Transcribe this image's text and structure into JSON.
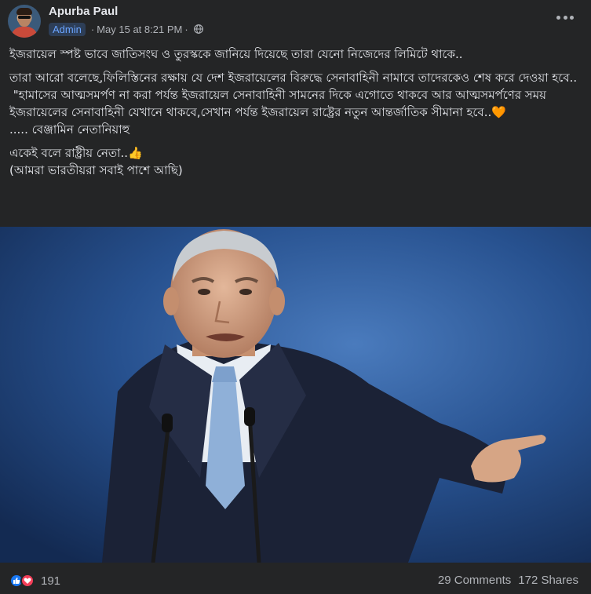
{
  "post": {
    "author": "Apurba Paul",
    "role_badge": "Admin",
    "timestamp": "May 15 at 8:21 PM",
    "separator": "·",
    "privacy_icon": "globe-icon",
    "more_icon": "more-options-icon"
  },
  "content": {
    "line1": "ইজরায়েল স্পষ্ট ভাবে জাতিসংঘ ও তুরস্ককে জানিয়ে দিয়েছে তারা যেনো নিজেদের লিমিটে থাকে..",
    "line2": "তারা আরো বলেছে,ফিলিস্তিনের রক্ষায় যে দেশ ইজরায়েলের বিরুদ্ধে সেনাবাহিনী নামাবে তাদেরকেও শেষ করে দেওয়া হবে..",
    "line3": " \"হামাসের আত্মসমর্পণ না করা পর্যন্ত ইজরায়েল সেনাবাহিনী সামনের দিকে এগোতে থাকবে আর আত্মসমর্পণের সময় ইজরায়েলের সেনাবাহিনী যেখানে থাকবে,সেখান পর্যন্ত ইজরায়েল রাষ্ট্রের নতুন আন্তর্জাতিক সীমানা হবে..🧡",
    "line4": "..... বেঞ্জামিন নেতানিয়াহু",
    "line5": "একেই বলে রাষ্ট্রীয় নেতা..👍",
    "line6": "(আমরা ভারতীয়রা সবাই পাশে আছি)"
  },
  "reactions": {
    "icons": [
      "like-icon",
      "love-icon"
    ],
    "count": "191",
    "like_color": "#1877f2",
    "love_color": "#f33e58"
  },
  "stats": {
    "comments": "29 Comments",
    "shares": "172 Shares"
  },
  "colors": {
    "background": "#242526",
    "text": "#e4e6eb",
    "secondary_text": "#b0b3b8",
    "badge_text": "#6aa4ff"
  }
}
